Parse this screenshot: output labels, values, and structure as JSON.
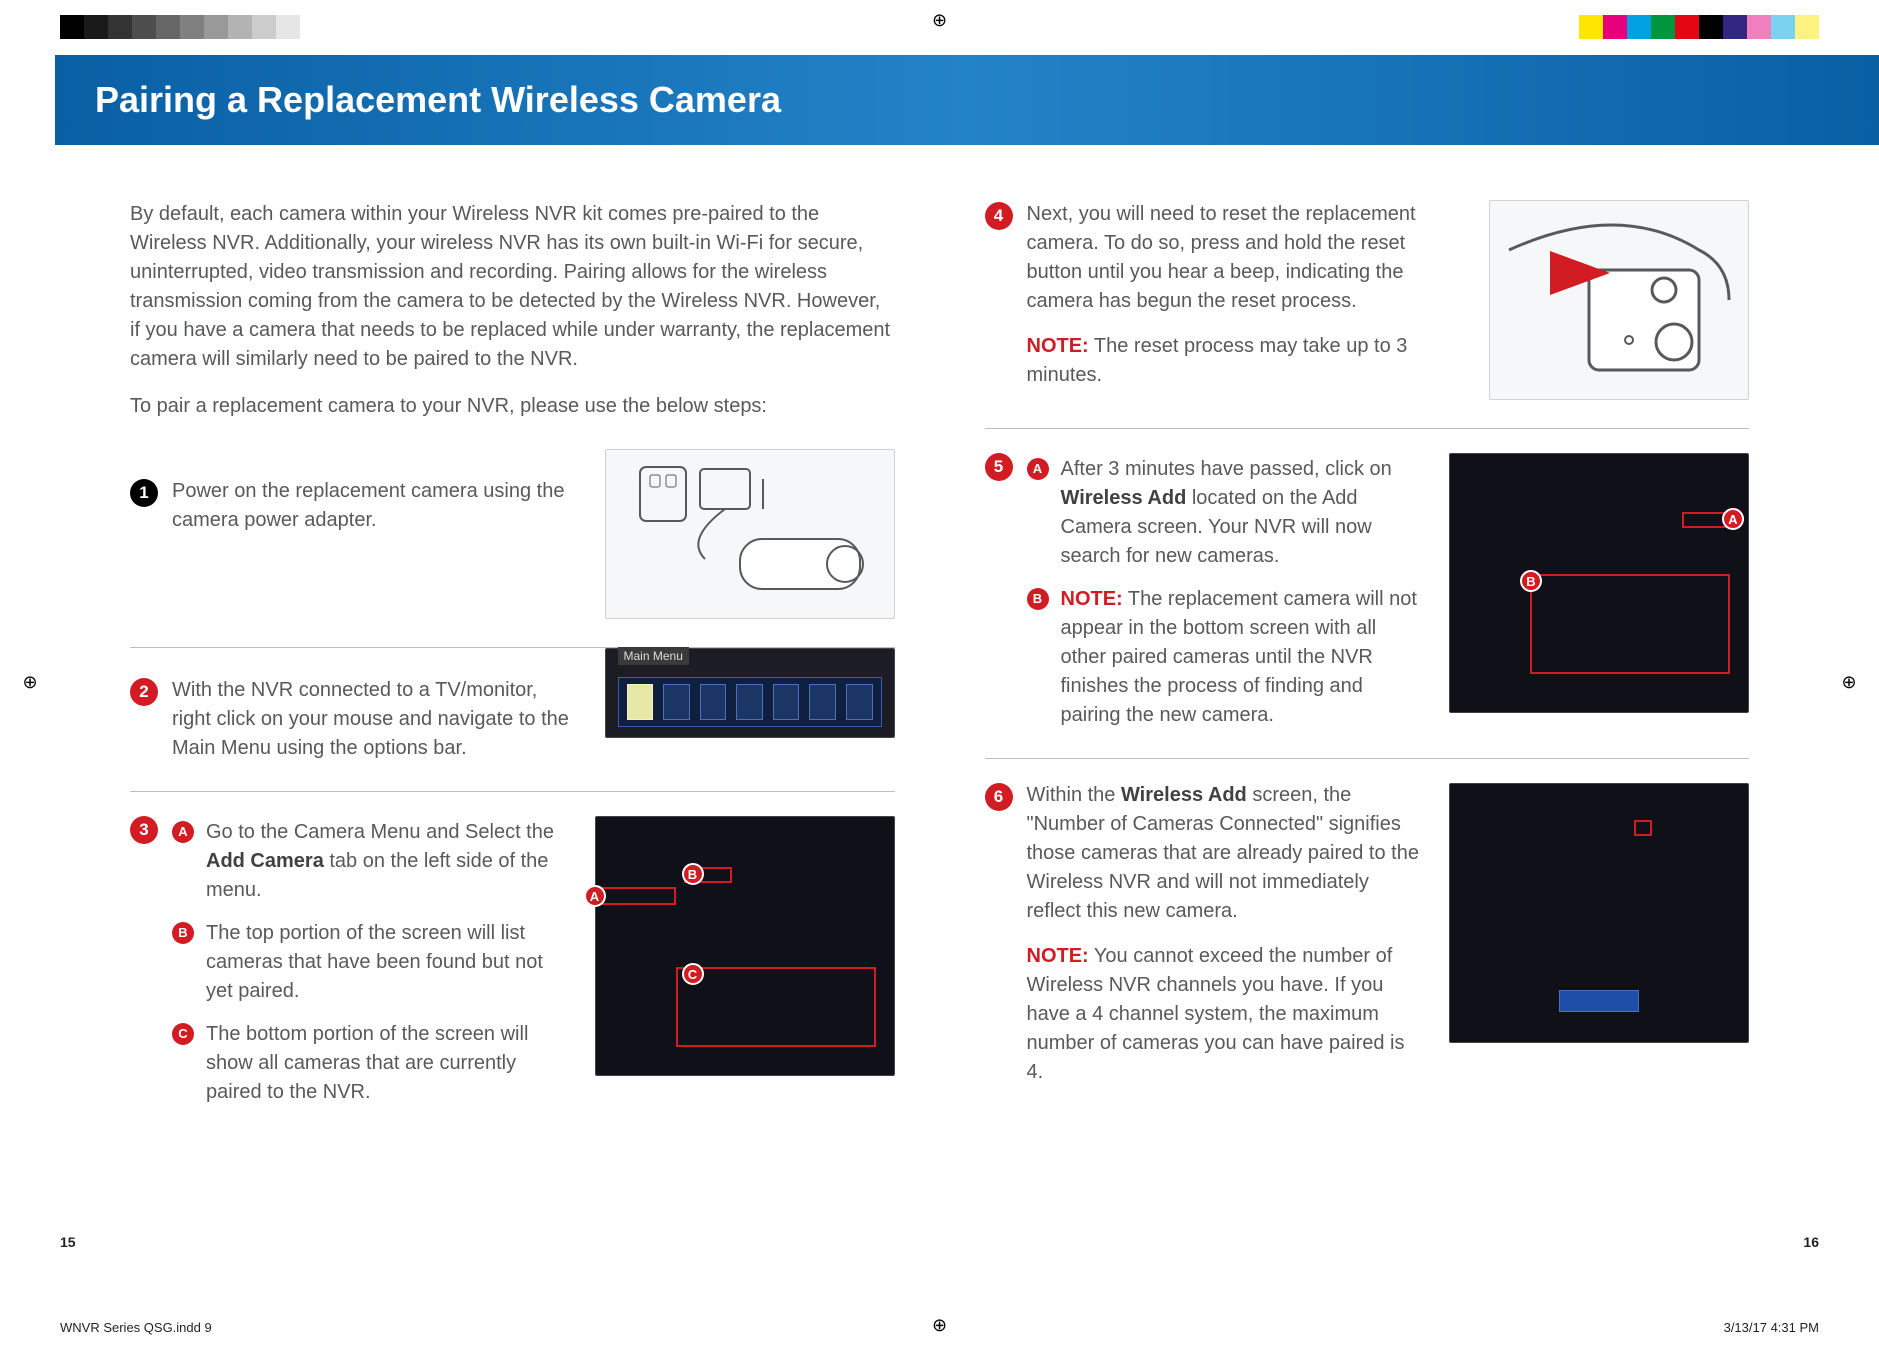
{
  "header": {
    "title": "Pairing a Replacement Wireless Camera"
  },
  "left": {
    "intro": "By default, each camera within your Wireless NVR kit comes pre-paired to the Wireless NVR. Additionally, your wireless NVR has its own built-in Wi-Fi for secure, uninterrupted, video transmission and recording. Pairing allows for the wireless transmission coming from the camera to be detected by the Wireless NVR. However, if you have a camera that needs to be replaced while under warranty, the replacement camera will similarly need to be paired to the NVR.",
    "sub": "To pair a replacement camera to your NVR, please use the below steps:",
    "step1": "Power on the replacement camera using the camera power adapter.",
    "step2": "With the NVR connected to a TV/monitor, right click on your mouse and navigate to the Main Menu using the options bar.",
    "step3_a_pre": "Go to the Camera Menu and Select the ",
    "step3_a_bold": "Add Camera",
    "step3_a_post": " tab on the left side of the menu.",
    "step3_b": "The top portion of the screen will list cameras that have been found but not yet paired.",
    "step3_c": "The bottom portion of the screen will show all cameras that are currently paired to the NVR.",
    "menu_label": "Main Menu"
  },
  "right": {
    "step4": "Next, you will need to reset the replacement camera. To do so, press and hold the reset button until you hear a beep, indicating the camera has begun the reset process.",
    "step4_note_label": "NOTE:",
    "step4_note": " The reset process may take up to 3 minutes.",
    "step5_a_pre": "After 3 minutes have passed, click on ",
    "step5_a_bold": "Wireless Add",
    "step5_a_post": " located on the Add Camera screen. Your NVR will now search for new cameras.",
    "step5_b_label": "NOTE:",
    "step5_b": " The replacement camera will not appear in the bottom screen with all other paired cameras until the NVR finishes the process of finding and pairing the new camera.",
    "step6_pre": "Within the ",
    "step6_bold": "Wireless Add",
    "step6_post": " screen, the \"Number of Cameras Connected\" signifies those cameras that are already paired to the Wireless NVR and will not immediately reflect this new camera.",
    "step6_note_label": "NOTE:",
    "step6_note": " You cannot exceed the number of Wireless NVR channels you have. If you have a 4 channel system, the maximum number of cameras you can have paired is 4."
  },
  "page": {
    "left_num": "15",
    "right_num": "16",
    "slug": "WNVR Series QSG.indd   9",
    "slug_right": "3/13/17   4:31 PM"
  },
  "step_numbers": {
    "s1": "1",
    "s2": "2",
    "s3": "3",
    "s4": "4",
    "s5": "5",
    "s6": "6"
  },
  "sub_letters": {
    "a": "A",
    "b": "B",
    "c": "C"
  }
}
